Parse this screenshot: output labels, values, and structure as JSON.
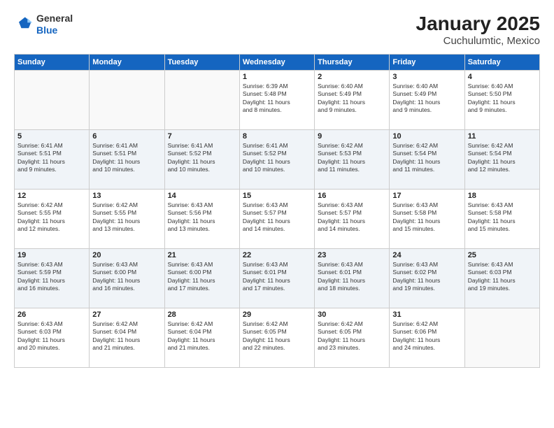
{
  "logo": {
    "general": "General",
    "blue": "Blue"
  },
  "title": "January 2025",
  "subtitle": "Cuchulumtic, Mexico",
  "days_of_week": [
    "Sunday",
    "Monday",
    "Tuesday",
    "Wednesday",
    "Thursday",
    "Friday",
    "Saturday"
  ],
  "weeks": [
    [
      {
        "day": "",
        "info": ""
      },
      {
        "day": "",
        "info": ""
      },
      {
        "day": "",
        "info": ""
      },
      {
        "day": "1",
        "info": "Sunrise: 6:39 AM\nSunset: 5:48 PM\nDaylight: 11 hours\nand 8 minutes."
      },
      {
        "day": "2",
        "info": "Sunrise: 6:40 AM\nSunset: 5:49 PM\nDaylight: 11 hours\nand 9 minutes."
      },
      {
        "day": "3",
        "info": "Sunrise: 6:40 AM\nSunset: 5:49 PM\nDaylight: 11 hours\nand 9 minutes."
      },
      {
        "day": "4",
        "info": "Sunrise: 6:40 AM\nSunset: 5:50 PM\nDaylight: 11 hours\nand 9 minutes."
      }
    ],
    [
      {
        "day": "5",
        "info": "Sunrise: 6:41 AM\nSunset: 5:51 PM\nDaylight: 11 hours\nand 9 minutes."
      },
      {
        "day": "6",
        "info": "Sunrise: 6:41 AM\nSunset: 5:51 PM\nDaylight: 11 hours\nand 10 minutes."
      },
      {
        "day": "7",
        "info": "Sunrise: 6:41 AM\nSunset: 5:52 PM\nDaylight: 11 hours\nand 10 minutes."
      },
      {
        "day": "8",
        "info": "Sunrise: 6:41 AM\nSunset: 5:52 PM\nDaylight: 11 hours\nand 10 minutes."
      },
      {
        "day": "9",
        "info": "Sunrise: 6:42 AM\nSunset: 5:53 PM\nDaylight: 11 hours\nand 11 minutes."
      },
      {
        "day": "10",
        "info": "Sunrise: 6:42 AM\nSunset: 5:54 PM\nDaylight: 11 hours\nand 11 minutes."
      },
      {
        "day": "11",
        "info": "Sunrise: 6:42 AM\nSunset: 5:54 PM\nDaylight: 11 hours\nand 12 minutes."
      }
    ],
    [
      {
        "day": "12",
        "info": "Sunrise: 6:42 AM\nSunset: 5:55 PM\nDaylight: 11 hours\nand 12 minutes."
      },
      {
        "day": "13",
        "info": "Sunrise: 6:42 AM\nSunset: 5:55 PM\nDaylight: 11 hours\nand 13 minutes."
      },
      {
        "day": "14",
        "info": "Sunrise: 6:43 AM\nSunset: 5:56 PM\nDaylight: 11 hours\nand 13 minutes."
      },
      {
        "day": "15",
        "info": "Sunrise: 6:43 AM\nSunset: 5:57 PM\nDaylight: 11 hours\nand 14 minutes."
      },
      {
        "day": "16",
        "info": "Sunrise: 6:43 AM\nSunset: 5:57 PM\nDaylight: 11 hours\nand 14 minutes."
      },
      {
        "day": "17",
        "info": "Sunrise: 6:43 AM\nSunset: 5:58 PM\nDaylight: 11 hours\nand 15 minutes."
      },
      {
        "day": "18",
        "info": "Sunrise: 6:43 AM\nSunset: 5:58 PM\nDaylight: 11 hours\nand 15 minutes."
      }
    ],
    [
      {
        "day": "19",
        "info": "Sunrise: 6:43 AM\nSunset: 5:59 PM\nDaylight: 11 hours\nand 16 minutes."
      },
      {
        "day": "20",
        "info": "Sunrise: 6:43 AM\nSunset: 6:00 PM\nDaylight: 11 hours\nand 16 minutes."
      },
      {
        "day": "21",
        "info": "Sunrise: 6:43 AM\nSunset: 6:00 PM\nDaylight: 11 hours\nand 17 minutes."
      },
      {
        "day": "22",
        "info": "Sunrise: 6:43 AM\nSunset: 6:01 PM\nDaylight: 11 hours\nand 17 minutes."
      },
      {
        "day": "23",
        "info": "Sunrise: 6:43 AM\nSunset: 6:01 PM\nDaylight: 11 hours\nand 18 minutes."
      },
      {
        "day": "24",
        "info": "Sunrise: 6:43 AM\nSunset: 6:02 PM\nDaylight: 11 hours\nand 19 minutes."
      },
      {
        "day": "25",
        "info": "Sunrise: 6:43 AM\nSunset: 6:03 PM\nDaylight: 11 hours\nand 19 minutes."
      }
    ],
    [
      {
        "day": "26",
        "info": "Sunrise: 6:43 AM\nSunset: 6:03 PM\nDaylight: 11 hours\nand 20 minutes."
      },
      {
        "day": "27",
        "info": "Sunrise: 6:42 AM\nSunset: 6:04 PM\nDaylight: 11 hours\nand 21 minutes."
      },
      {
        "day": "28",
        "info": "Sunrise: 6:42 AM\nSunset: 6:04 PM\nDaylight: 11 hours\nand 21 minutes."
      },
      {
        "day": "29",
        "info": "Sunrise: 6:42 AM\nSunset: 6:05 PM\nDaylight: 11 hours\nand 22 minutes."
      },
      {
        "day": "30",
        "info": "Sunrise: 6:42 AM\nSunset: 6:05 PM\nDaylight: 11 hours\nand 23 minutes."
      },
      {
        "day": "31",
        "info": "Sunrise: 6:42 AM\nSunset: 6:06 PM\nDaylight: 11 hours\nand 24 minutes."
      },
      {
        "day": "",
        "info": ""
      }
    ]
  ]
}
